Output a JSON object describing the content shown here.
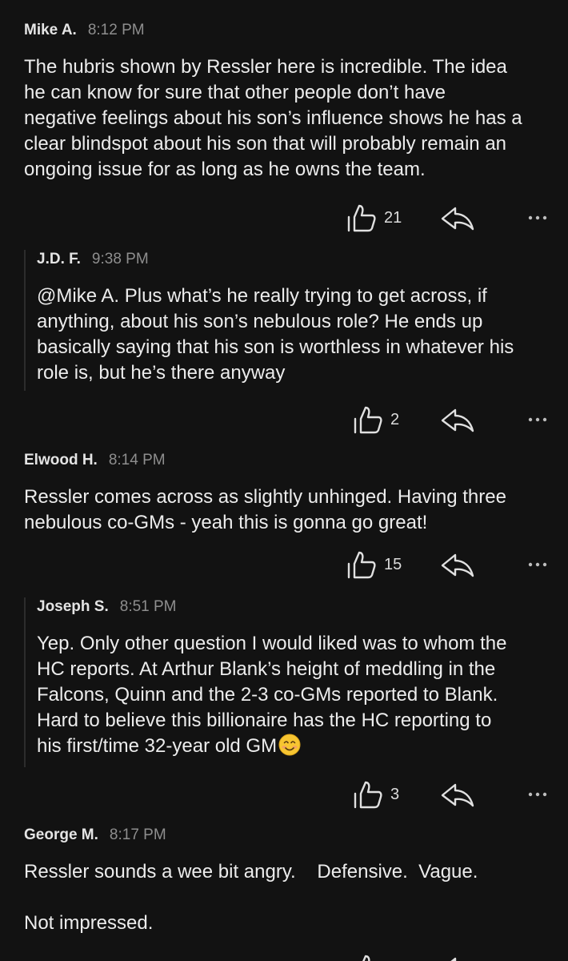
{
  "comments": [
    {
      "author": "Mike A.",
      "time": "8:12 PM",
      "lines": [
        "The hubris shown by Ressler here is incredible. The idea",
        "he can know for sure that other people don’t have",
        "negative feelings about his son’s influence shows he has a",
        "clear blindspot about his son that will probably remain an",
        "ongoing issue for as long as he owns the team."
      ],
      "likes": "21"
    },
    {
      "author": "J.D. F.",
      "time": "9:38 PM",
      "lines": [
        "@Mike A. Plus what’s he really trying to get across, if",
        "anything, about his son’s nebulous role? He ends up",
        "basically saying that his son is worthless in whatever his",
        "role is, but he’s there anyway"
      ],
      "likes": "2"
    },
    {
      "author": "Elwood H.",
      "time": "8:14 PM",
      "lines": [
        "Ressler comes across as slightly unhinged. Having three",
        "nebulous co-GMs - yeah this is gonna go great!"
      ],
      "likes": "15"
    },
    {
      "author": "Joseph S.",
      "time": "8:51 PM",
      "lines": [
        "Yep.  Only other question I would liked was to whom the",
        "HC reports.  At Arthur Blank’s height of meddling in the",
        "Falcons, Quinn and the 2-3 co-GMs reported to Blank.",
        "Hard to believe this billionaire has the HC reporting to",
        "his first/time 32-year old GM"
      ],
      "emoji": "smiling-face-emoji",
      "likes": "3"
    },
    {
      "author": "George M.",
      "time": "8:17 PM",
      "line1": "Ressler sounds a wee bit angry.    Defensive.  Vague.",
      "line2": "Not impressed."
    }
  ],
  "icons": {
    "like": "thumbs-up-icon",
    "reply": "reply-arrow-icon",
    "more": "more-dots-icon"
  },
  "colors": {
    "background": "#121212",
    "text": "#ececec",
    "timestamp": "#8e8e8e",
    "icon": "#e0e0e0",
    "thread_line": "#2c2c2c"
  }
}
